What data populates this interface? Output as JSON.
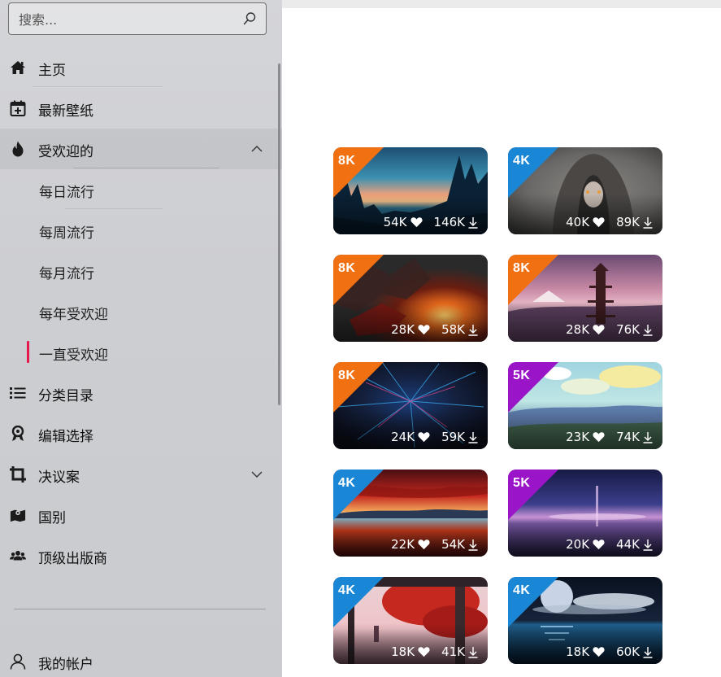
{
  "search": {
    "placeholder": "搜索..."
  },
  "nav": {
    "home": "主页",
    "latest": "最新壁纸",
    "popular": "受欢迎的",
    "sub": [
      "每日流行",
      "每周流行",
      "每月流行",
      "每年受欢迎",
      "一直受欢迎"
    ],
    "categories": "分类目录",
    "editors_choice": "编辑选择",
    "resolution": "决议案",
    "country": "国别",
    "top_publishers": "顶级出版商",
    "account": "我的帐户"
  },
  "accent": "#e8174d",
  "cards": [
    {
      "res": "8K",
      "likes": "54K",
      "downloads": "146K",
      "badge_color": "#f07012",
      "theme": "forest-sunset"
    },
    {
      "res": "4K",
      "likes": "40K",
      "downloads": "89K",
      "badge_color": "#1a86d6",
      "theme": "hooded-girl"
    },
    {
      "res": "8K",
      "likes": "28K",
      "downloads": "58K",
      "badge_color": "#f07012",
      "theme": "dragon"
    },
    {
      "res": "8K",
      "likes": "28K",
      "downloads": "76K",
      "badge_color": "#f07012",
      "theme": "pagoda"
    },
    {
      "res": "8K",
      "likes": "24K",
      "downloads": "59K",
      "badge_color": "#f07012",
      "theme": "blue-burst"
    },
    {
      "res": "5K",
      "likes": "23K",
      "downloads": "74K",
      "badge_color": "#9b15c8",
      "theme": "anime-valley"
    },
    {
      "res": "4K",
      "likes": "22K",
      "downloads": "54K",
      "badge_color": "#1a86d6",
      "theme": "red-sky-lake"
    },
    {
      "res": "5K",
      "likes": "20K",
      "downloads": "44K",
      "badge_color": "#9b15c8",
      "theme": "purple-horizon"
    },
    {
      "res": "4K",
      "likes": "18K",
      "downloads": "41K",
      "badge_color": "#1a86d6",
      "theme": "red-tree"
    },
    {
      "res": "4K",
      "likes": "18K",
      "downloads": "60K",
      "badge_color": "#1a86d6",
      "theme": "moon-sea"
    }
  ]
}
